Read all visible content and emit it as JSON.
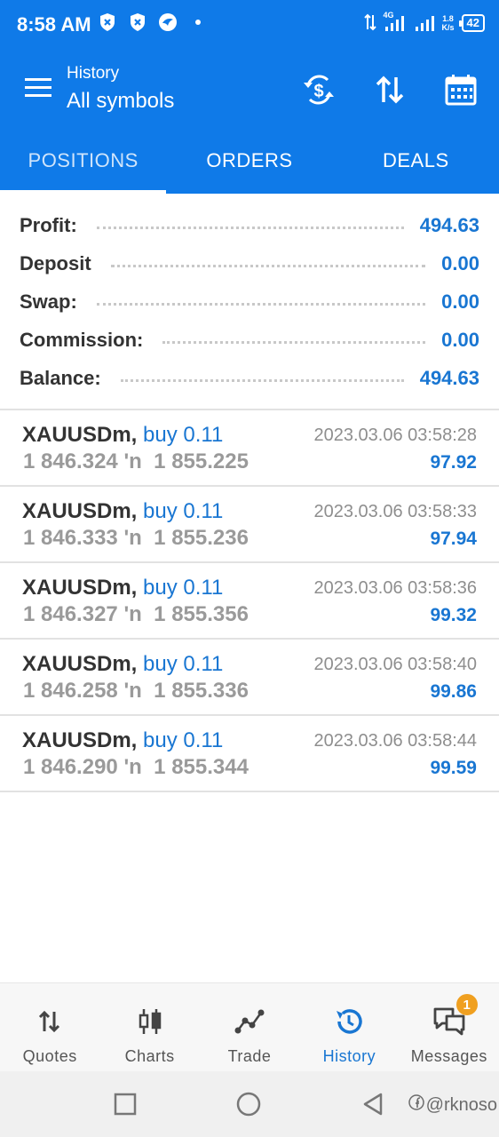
{
  "status_bar": {
    "time": "8:58 AM",
    "network": "4G",
    "speed_value": "1.8",
    "speed_unit": "K/s",
    "battery": "42"
  },
  "app_bar": {
    "subtitle": "History",
    "title": "All symbols",
    "icons": [
      "menu-icon",
      "dollar-refresh-icon",
      "sort-icon",
      "calendar-icon"
    ]
  },
  "tabs": [
    {
      "label": "POSITIONS",
      "active": true
    },
    {
      "label": "ORDERS",
      "active": false
    },
    {
      "label": "DEALS",
      "active": false
    }
  ],
  "summary": [
    {
      "label": "Profit:",
      "value": "494.63"
    },
    {
      "label": "Deposit",
      "value": "0.00"
    },
    {
      "label": "Swap:",
      "value": "0.00"
    },
    {
      "label": "Commission:",
      "value": "0.00"
    },
    {
      "label": "Balance:",
      "value": "494.63"
    }
  ],
  "deals": [
    {
      "symbol": "XAUUSDm,",
      "side": "buy 0.11",
      "open_price": "1 846.324",
      "arrow": "'n",
      "close_price": "1 855.225",
      "time": "2023.03.06 03:58:28",
      "profit": "97.92"
    },
    {
      "symbol": "XAUUSDm,",
      "side": "buy 0.11",
      "open_price": "1 846.333",
      "arrow": "'n",
      "close_price": "1 855.236",
      "time": "2023.03.06 03:58:33",
      "profit": "97.94"
    },
    {
      "symbol": "XAUUSDm,",
      "side": "buy 0.11",
      "open_price": "1 846.327",
      "arrow": "'n",
      "close_price": "1 855.356",
      "time": "2023.03.06 03:58:36",
      "profit": "99.32"
    },
    {
      "symbol": "XAUUSDm,",
      "side": "buy 0.11",
      "open_price": "1 846.258",
      "arrow": "'n",
      "close_price": "1 855.336",
      "time": "2023.03.06 03:58:40",
      "profit": "99.86"
    },
    {
      "symbol": "XAUUSDm,",
      "side": "buy 0.11",
      "open_price": "1 846.290",
      "arrow": "'n",
      "close_price": "1 855.344",
      "time": "2023.03.06 03:58:44",
      "profit": "99.59"
    }
  ],
  "bottom_nav": [
    {
      "label": "Quotes",
      "icon": "quotes-icon",
      "active": false
    },
    {
      "label": "Charts",
      "icon": "charts-icon",
      "active": false
    },
    {
      "label": "Trade",
      "icon": "trade-icon",
      "active": false
    },
    {
      "label": "History",
      "icon": "history-icon",
      "active": true
    },
    {
      "label": "Messages",
      "icon": "messages-icon",
      "active": false,
      "badge": "1"
    }
  ],
  "watermark": "@rknoso",
  "colors": {
    "primary": "#0f7ae8",
    "accent_text": "#1976d2",
    "badge": "#f0a020"
  }
}
